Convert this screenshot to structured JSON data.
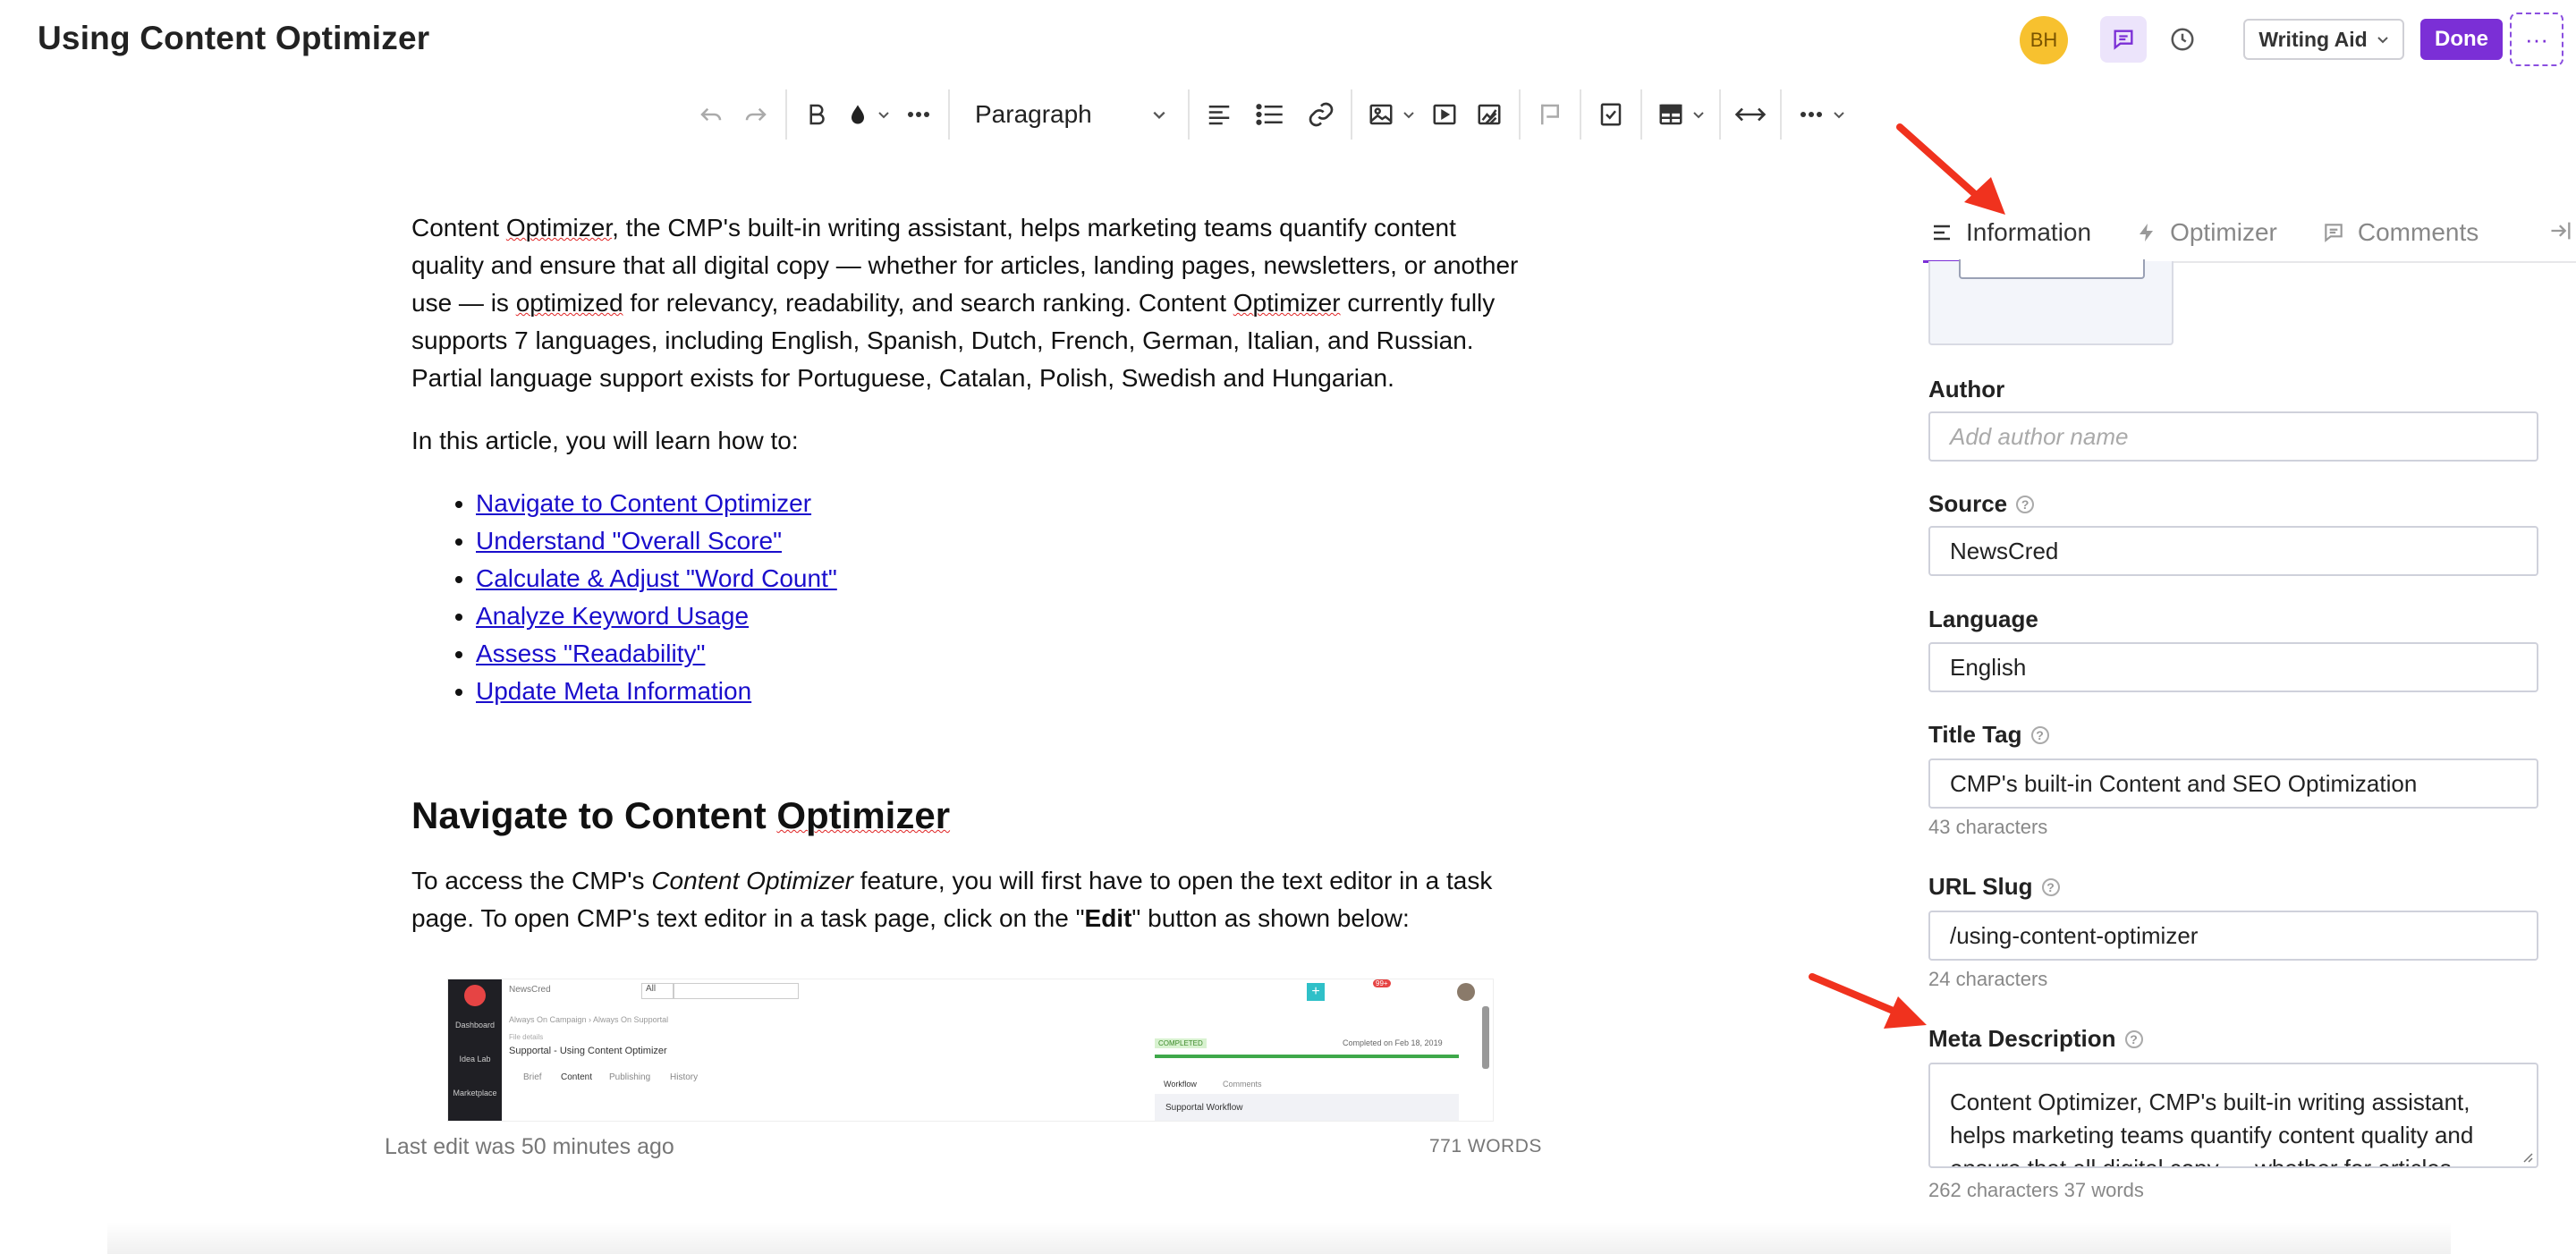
{
  "header": {
    "title": "Using Content Optimizer",
    "avatar_initials": "BH",
    "writing_aid_label": "Writing Aid",
    "done_label": "Done",
    "more_label": "···"
  },
  "toolbar": {
    "paragraph_style": "Paragraph",
    "icons": [
      "undo-icon",
      "redo-icon",
      "bold-icon",
      "text-color-icon",
      "more-formatting-icon",
      "align-icon",
      "bullet-list-icon",
      "link-icon",
      "image-icon",
      "video-icon",
      "chart-icon",
      "comment-flag-icon",
      "checkbox-icon",
      "table-icon",
      "full-width-icon",
      "more-icon"
    ]
  },
  "editor": {
    "intro": {
      "pre1": "Content ",
      "w1": "Optimizer",
      "post1": ", the CMP's built-in writing assistant, helps marketing teams quantify content quality and ensure that all digital copy — whether for articles, landing pages, newsletters, or another use — is ",
      "w2": "optimized",
      "post2": " for relevancy, readability, and search ranking. Content ",
      "w3": "Optimizer",
      "post3": " currently fully supports 7 languages, including English, Spanish, Dutch, French, German, Italian, and Russian. Partial language support exists for Portuguese, Catalan, Polish, Swedish and Hungarian."
    },
    "learn_intro": "In this article, you will learn how to:",
    "links": [
      "Navigate to Content Optimizer",
      "Understand \"Overall Score\"",
      "Calculate & Adjust \"Word Count\"",
      "Analyze Keyword Usage",
      "Assess \"Readability\"",
      "Update Meta Information"
    ],
    "heading": {
      "pre": "Navigate to Content ",
      "word": "Optimizer"
    },
    "access": {
      "p1": "To access the CMP's ",
      "em": "Content Optimizer",
      "p2": " feature, you will first have to open the text editor in a task page. To open CMP's text editor in a task page, click on the \"",
      "strong": "Edit",
      "p3": "\" button as shown below:"
    },
    "embed": {
      "brand": "NewsCred",
      "filter": "All",
      "nav": [
        "Dashboard",
        "Idea Lab",
        "Marketplace"
      ],
      "breadcrumb": "Always On Campaign › Always On Supportal",
      "task_type": "File details",
      "task_title": "Supportal - Using Content Optimizer",
      "tabs": [
        "Brief",
        "Content",
        "Publishing",
        "History"
      ],
      "status": "COMPLETED",
      "completed_on": "Completed on Feb 18, 2019",
      "side_tabs": [
        "Workflow",
        "Comments"
      ],
      "workflow": "Supportal Workflow",
      "badge": "99+"
    },
    "last_edit": "Last edit was 50 minutes ago",
    "word_count": "771 WORDS"
  },
  "panel": {
    "tabs": [
      {
        "label": "Information",
        "icon": "lines-icon"
      },
      {
        "label": "Optimizer",
        "icon": "bolt-icon"
      },
      {
        "label": "Comments",
        "icon": "comment-icon"
      }
    ],
    "author_label": "Author",
    "author_placeholder": "Add author name",
    "source_label": "Source",
    "source_value": "NewsCred",
    "language_label": "Language",
    "language_value": "English",
    "title_tag_label": "Title Tag",
    "title_tag_value": "CMP's built-in Content and SEO Optimization",
    "title_tag_count": "43 characters",
    "url_slug_label": "URL Slug",
    "url_slug_value": "/using-content-optimizer",
    "url_slug_count": "24 characters",
    "meta_label": "Meta Description",
    "meta_value": "Content Optimizer, CMP's built-in writing assistant, helps marketing teams quantify content quality and ensure that all digital copy — whether for articles, landing pages, newsletters, or another use — is optimized for relevancy, readability, and search ranking.",
    "meta_count": "262 characters 37 words"
  },
  "colors": {
    "accent": "#7b2fd6",
    "avatar": "#f7c12f",
    "link": "#1a0dcc",
    "annotation_arrow": "#f0321e"
  }
}
